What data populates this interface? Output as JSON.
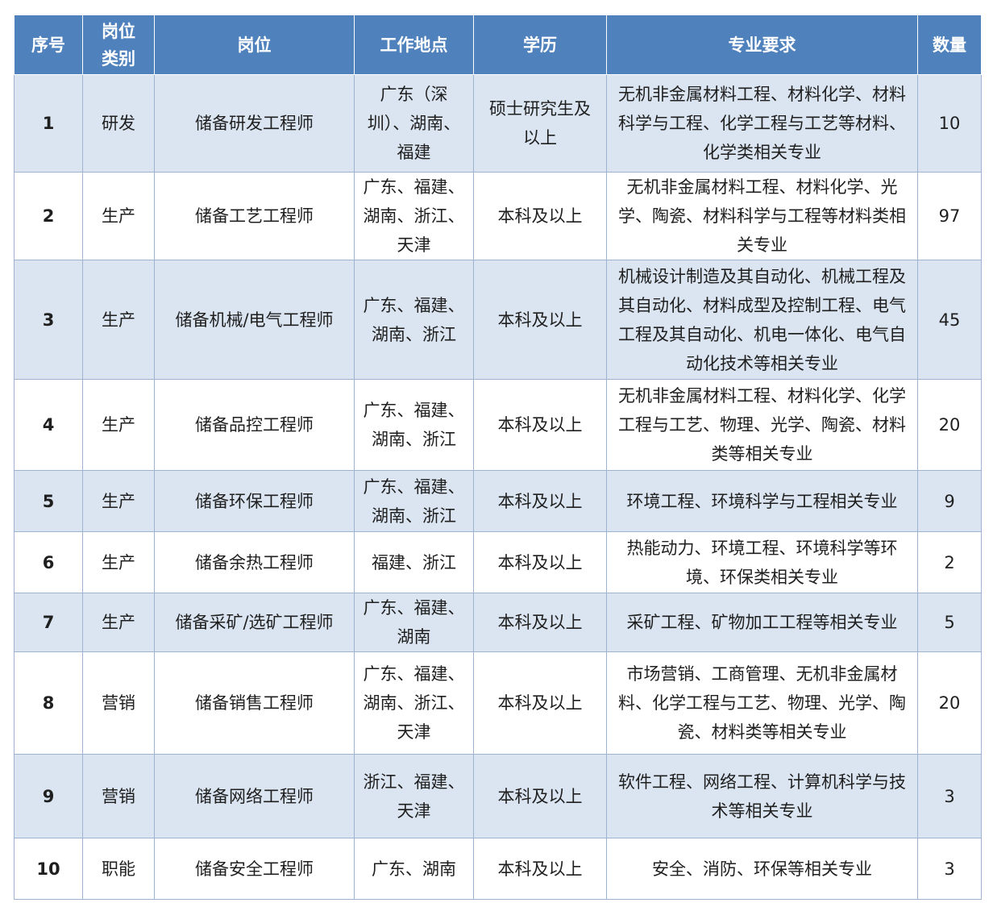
{
  "table": {
    "headers": {
      "seq": "序号",
      "category": "岗位类别",
      "position": "岗位",
      "location": "工作地点",
      "education": "学历",
      "major": "专业要求",
      "count": "数量"
    },
    "rows": [
      {
        "seq": "1",
        "category": "研发",
        "position": "储备研发工程师",
        "location": "广东（深圳）、湖南、福建",
        "education": "硕士研究生及以上",
        "major": "无机非金属材料工程、材料化学、材料科学与工程、化学工程与工艺等材料、化学类相关专业",
        "count": "10"
      },
      {
        "seq": "2",
        "category": "生产",
        "position": "储备工艺工程师",
        "location": "广东、福建、湖南、浙江、天津",
        "education": "本科及以上",
        "major": "无机非金属材料工程、材料化学、光学、陶瓷、材料科学与工程等材料类相关专业",
        "count": "97"
      },
      {
        "seq": "3",
        "category": "生产",
        "position": "储备机械/电气工程师",
        "location": "广东、福建、湖南、浙江",
        "education": "本科及以上",
        "major": "机械设计制造及其自动化、机械工程及其自动化、材料成型及控制工程、电气工程及其自动化、机电一体化、电气自动化技术等相关专业",
        "count": "45"
      },
      {
        "seq": "4",
        "category": "生产",
        "position": "储备品控工程师",
        "location": "广东、福建、湖南、浙江",
        "education": "本科及以上",
        "major": "无机非金属材料工程、材料化学、化学工程与工艺、物理、光学、陶瓷、材料类等相关专业",
        "count": "20"
      },
      {
        "seq": "5",
        "category": "生产",
        "position": "储备环保工程师",
        "location": "广东、福建、湖南、浙江",
        "education": "本科及以上",
        "major": "环境工程、环境科学与工程相关专业",
        "count": "9"
      },
      {
        "seq": "6",
        "category": "生产",
        "position": "储备余热工程师",
        "location": "福建、浙江",
        "education": "本科及以上",
        "major": "热能动力、环境工程、环境科学等环境、环保类相关专业",
        "count": "2"
      },
      {
        "seq": "7",
        "category": "生产",
        "position": "储备采矿/选矿工程师",
        "location": "广东、福建、湖南",
        "education": "本科及以上",
        "major": "采矿工程、矿物加工工程等相关专业",
        "count": "5"
      },
      {
        "seq": "8",
        "category": "营销",
        "position": "储备销售工程师",
        "location": "广东、福建、湖南、浙江、天津",
        "education": "本科及以上",
        "major": "市场营销、工商管理、无机非金属材料、化学工程与工艺、物理、光学、陶瓷、材料类等相关专业",
        "count": "20"
      },
      {
        "seq": "9",
        "category": "营销",
        "position": "储备网络工程师",
        "location": "浙江、福建、天津",
        "education": "本科及以上",
        "major": "软件工程、网络工程、计算机科学与技术等相关专业",
        "count": "3"
      },
      {
        "seq": "10",
        "category": "职能",
        "position": "储备安全工程师",
        "location": "广东、湖南",
        "education": "本科及以上",
        "major": "安全、消防、环保等相关专业",
        "count": "3"
      }
    ],
    "colors": {
      "header_bg": "#4f81bd",
      "header_text": "#ffffff",
      "stripe": "#dbe5f1",
      "border": "#9db3d1"
    }
  }
}
